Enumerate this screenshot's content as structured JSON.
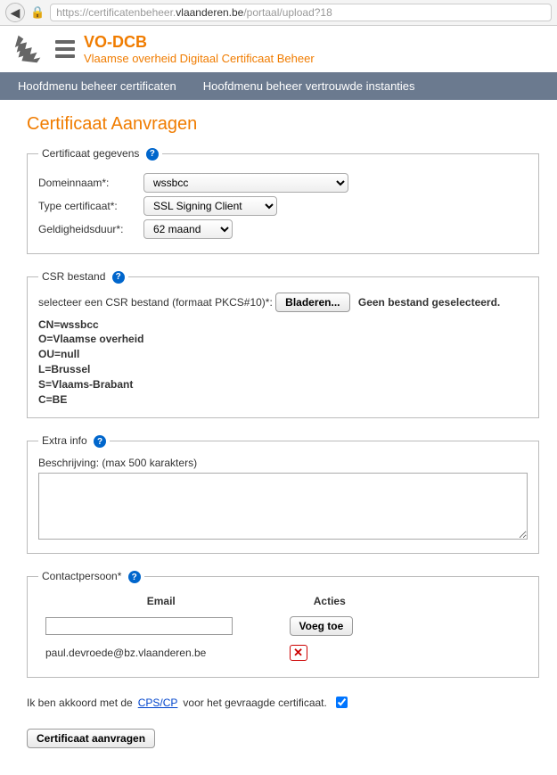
{
  "browser": {
    "url_prefix": "https://certificatenbeheer.",
    "url_domain": "vlaanderen.be",
    "url_path": "/portaal/upload?18"
  },
  "header": {
    "app_name": "VO-DCB",
    "subtitle": "Vlaamse overheid Digitaal Certificaat Beheer"
  },
  "menu": {
    "item1": "Hoofdmenu beheer certificaten",
    "item2": "Hoofdmenu beheer vertrouwde instanties"
  },
  "page": {
    "title": "Certificaat Aanvragen"
  },
  "section_cert": {
    "legend": "Certificaat gegevens",
    "help": "?",
    "domain_label": "Domeinnaam*:",
    "domain_value": "wssbcc",
    "type_label": "Type certificaat*:",
    "type_value": "SSL Signing Client",
    "duration_label": "Geldigheidsduur*:",
    "duration_value": "62 maand"
  },
  "section_csr": {
    "legend": "CSR bestand",
    "help": "?",
    "instruction": "selecteer een CSR bestand (formaat PKCS#10)*:",
    "browse_label": "Bladeren...",
    "no_file": "Geen bestand geselecteerd.",
    "line1": "CN=wssbcc",
    "line2": "O=Vlaamse overheid",
    "line3": "OU=null",
    "line4": "L=Brussel",
    "line5": "S=Vlaams-Brabant",
    "line6": "C=BE"
  },
  "section_extra": {
    "legend": "Extra info",
    "help": "?",
    "desc_label": "Beschrijving: (max 500 karakters)"
  },
  "section_contact": {
    "legend": "Contactpersoon*",
    "help": "?",
    "col_email": "Email",
    "col_actions": "Acties",
    "add_label": "Voeg toe",
    "existing_email": "paul.devroede@bz.vlaanderen.be"
  },
  "agree": {
    "prefix": "Ik ben akkoord met de ",
    "link": "CPS/CP",
    "suffix": " voor het gevraagde certificaat."
  },
  "submit": {
    "label": "Certificaat aanvragen"
  }
}
